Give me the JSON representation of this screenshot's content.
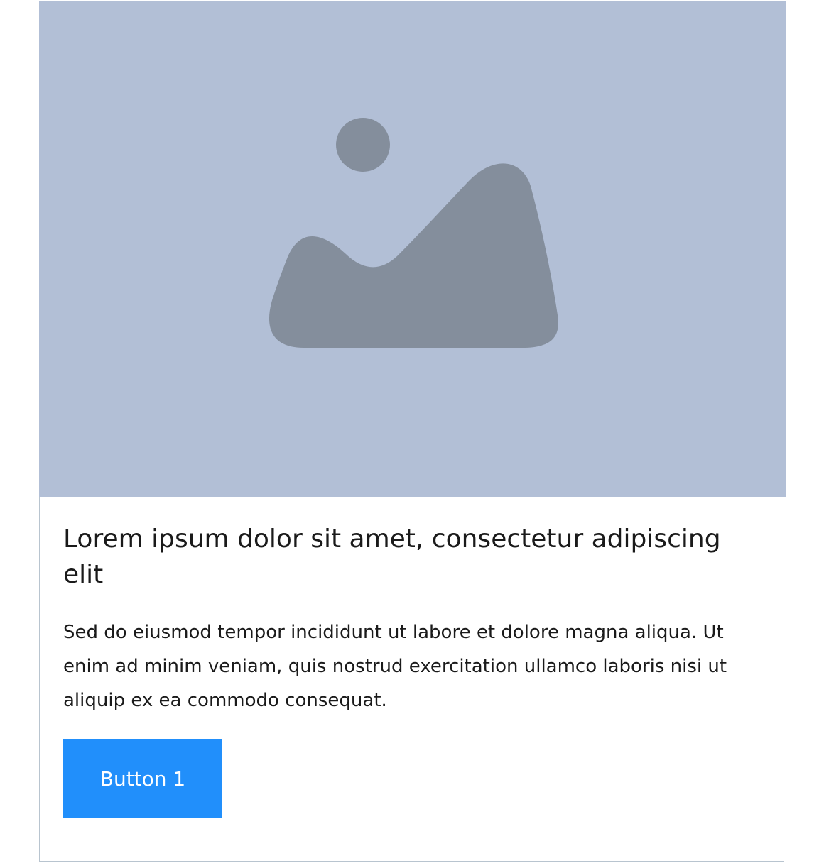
{
  "card": {
    "image": {
      "icon": "image-placeholder-icon",
      "background_color": "#b2bfd6",
      "icon_color": "#848e9c"
    },
    "title": "Lorem ipsum dolor sit amet, consectetur adipiscing elit",
    "description": "Sed do eiusmod tempor incididunt ut labore et dolore magna aliqua. Ut enim ad minim veniam, quis nostrud exercitation ullamco laboris nisi ut aliquip ex ea commodo consequat.",
    "button_label": "Button 1",
    "accent_color": "#218ffb"
  }
}
